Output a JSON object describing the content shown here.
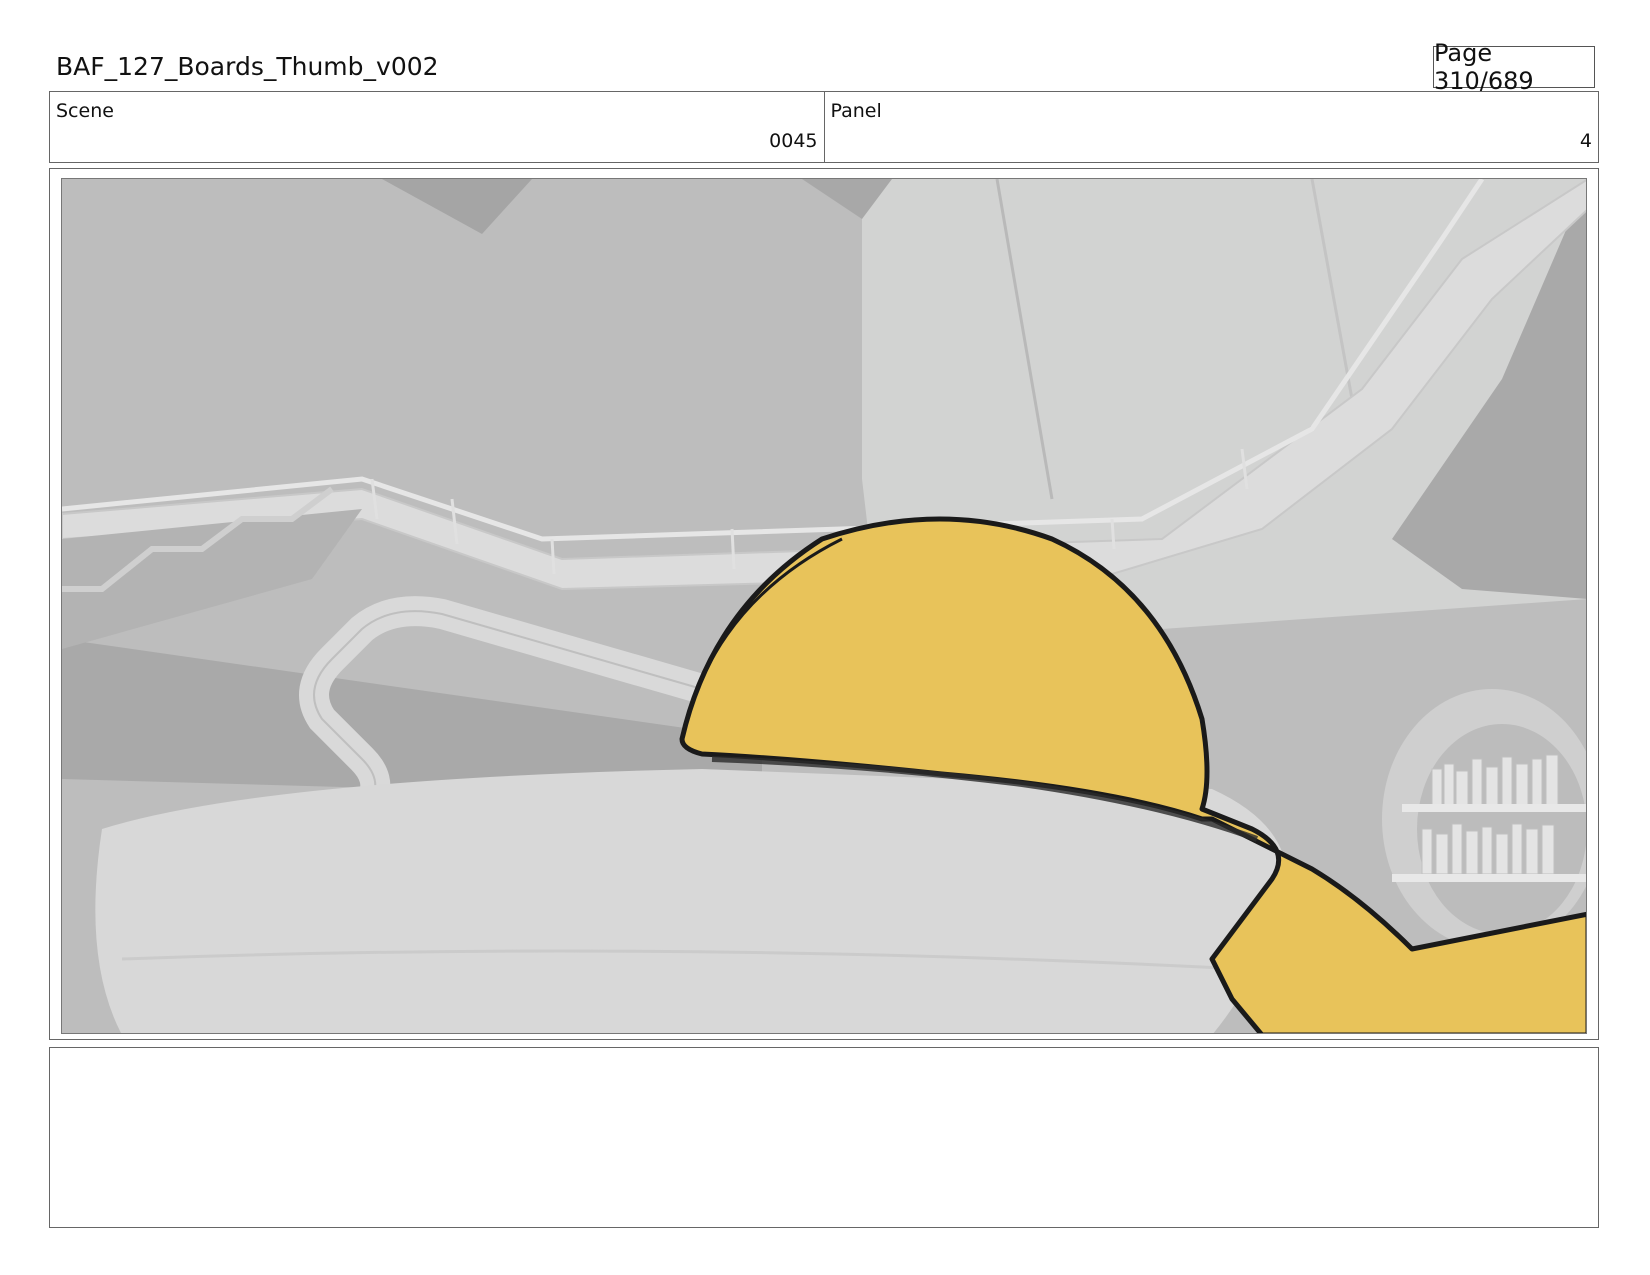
{
  "header": {
    "doc_title": "BAF_127_Boards_Thumb_v002",
    "page_label": "Page 310/689"
  },
  "info": {
    "scene_label": "Scene",
    "scene_value": "0045",
    "panel_label": "Panel",
    "panel_value": "4"
  },
  "panel": {
    "description_text": ""
  },
  "colors": {
    "character_fill": "#e8c35a",
    "outline": "#1a1a1a"
  }
}
